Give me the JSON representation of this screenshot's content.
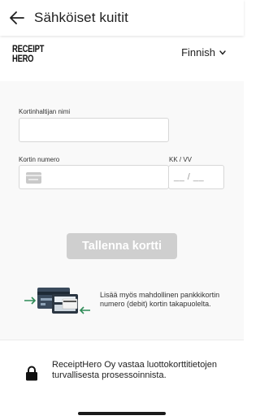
{
  "appbar": {
    "title": "Sähköiset kuitit",
    "back_icon": "arrow-left-icon"
  },
  "brand": {
    "logo_line1": "RECEIPT",
    "logo_line2": "HERO"
  },
  "language": {
    "selected": "Finnish",
    "icon": "chevron-down-icon"
  },
  "form": {
    "cardholder_label": "Kortinhaltijan nimi",
    "cardholder_value": "",
    "card_number_label": "Kortin numero",
    "card_number_value": "",
    "card_icon": "credit-card-icon",
    "expiry_label": "KK / VV",
    "expiry_placeholder": "__ / __",
    "save_label": "Tallenna kortti"
  },
  "hint": {
    "text": "Lisää myös mahdollinen pankkikortin numero (debit) kortin takapuolelta.",
    "illustration": "card-terminal-illustration"
  },
  "footer": {
    "text": "ReceiptHero Oy vastaa luottokorttitietojen turvallisesta prosessoinnista.",
    "icon": "lock-icon"
  },
  "colors": {
    "content_bg": "#f9f9f9",
    "button_disabled": "#cfcfcf",
    "accent_green": "#2e8b57",
    "text": "#1f1f1f"
  }
}
